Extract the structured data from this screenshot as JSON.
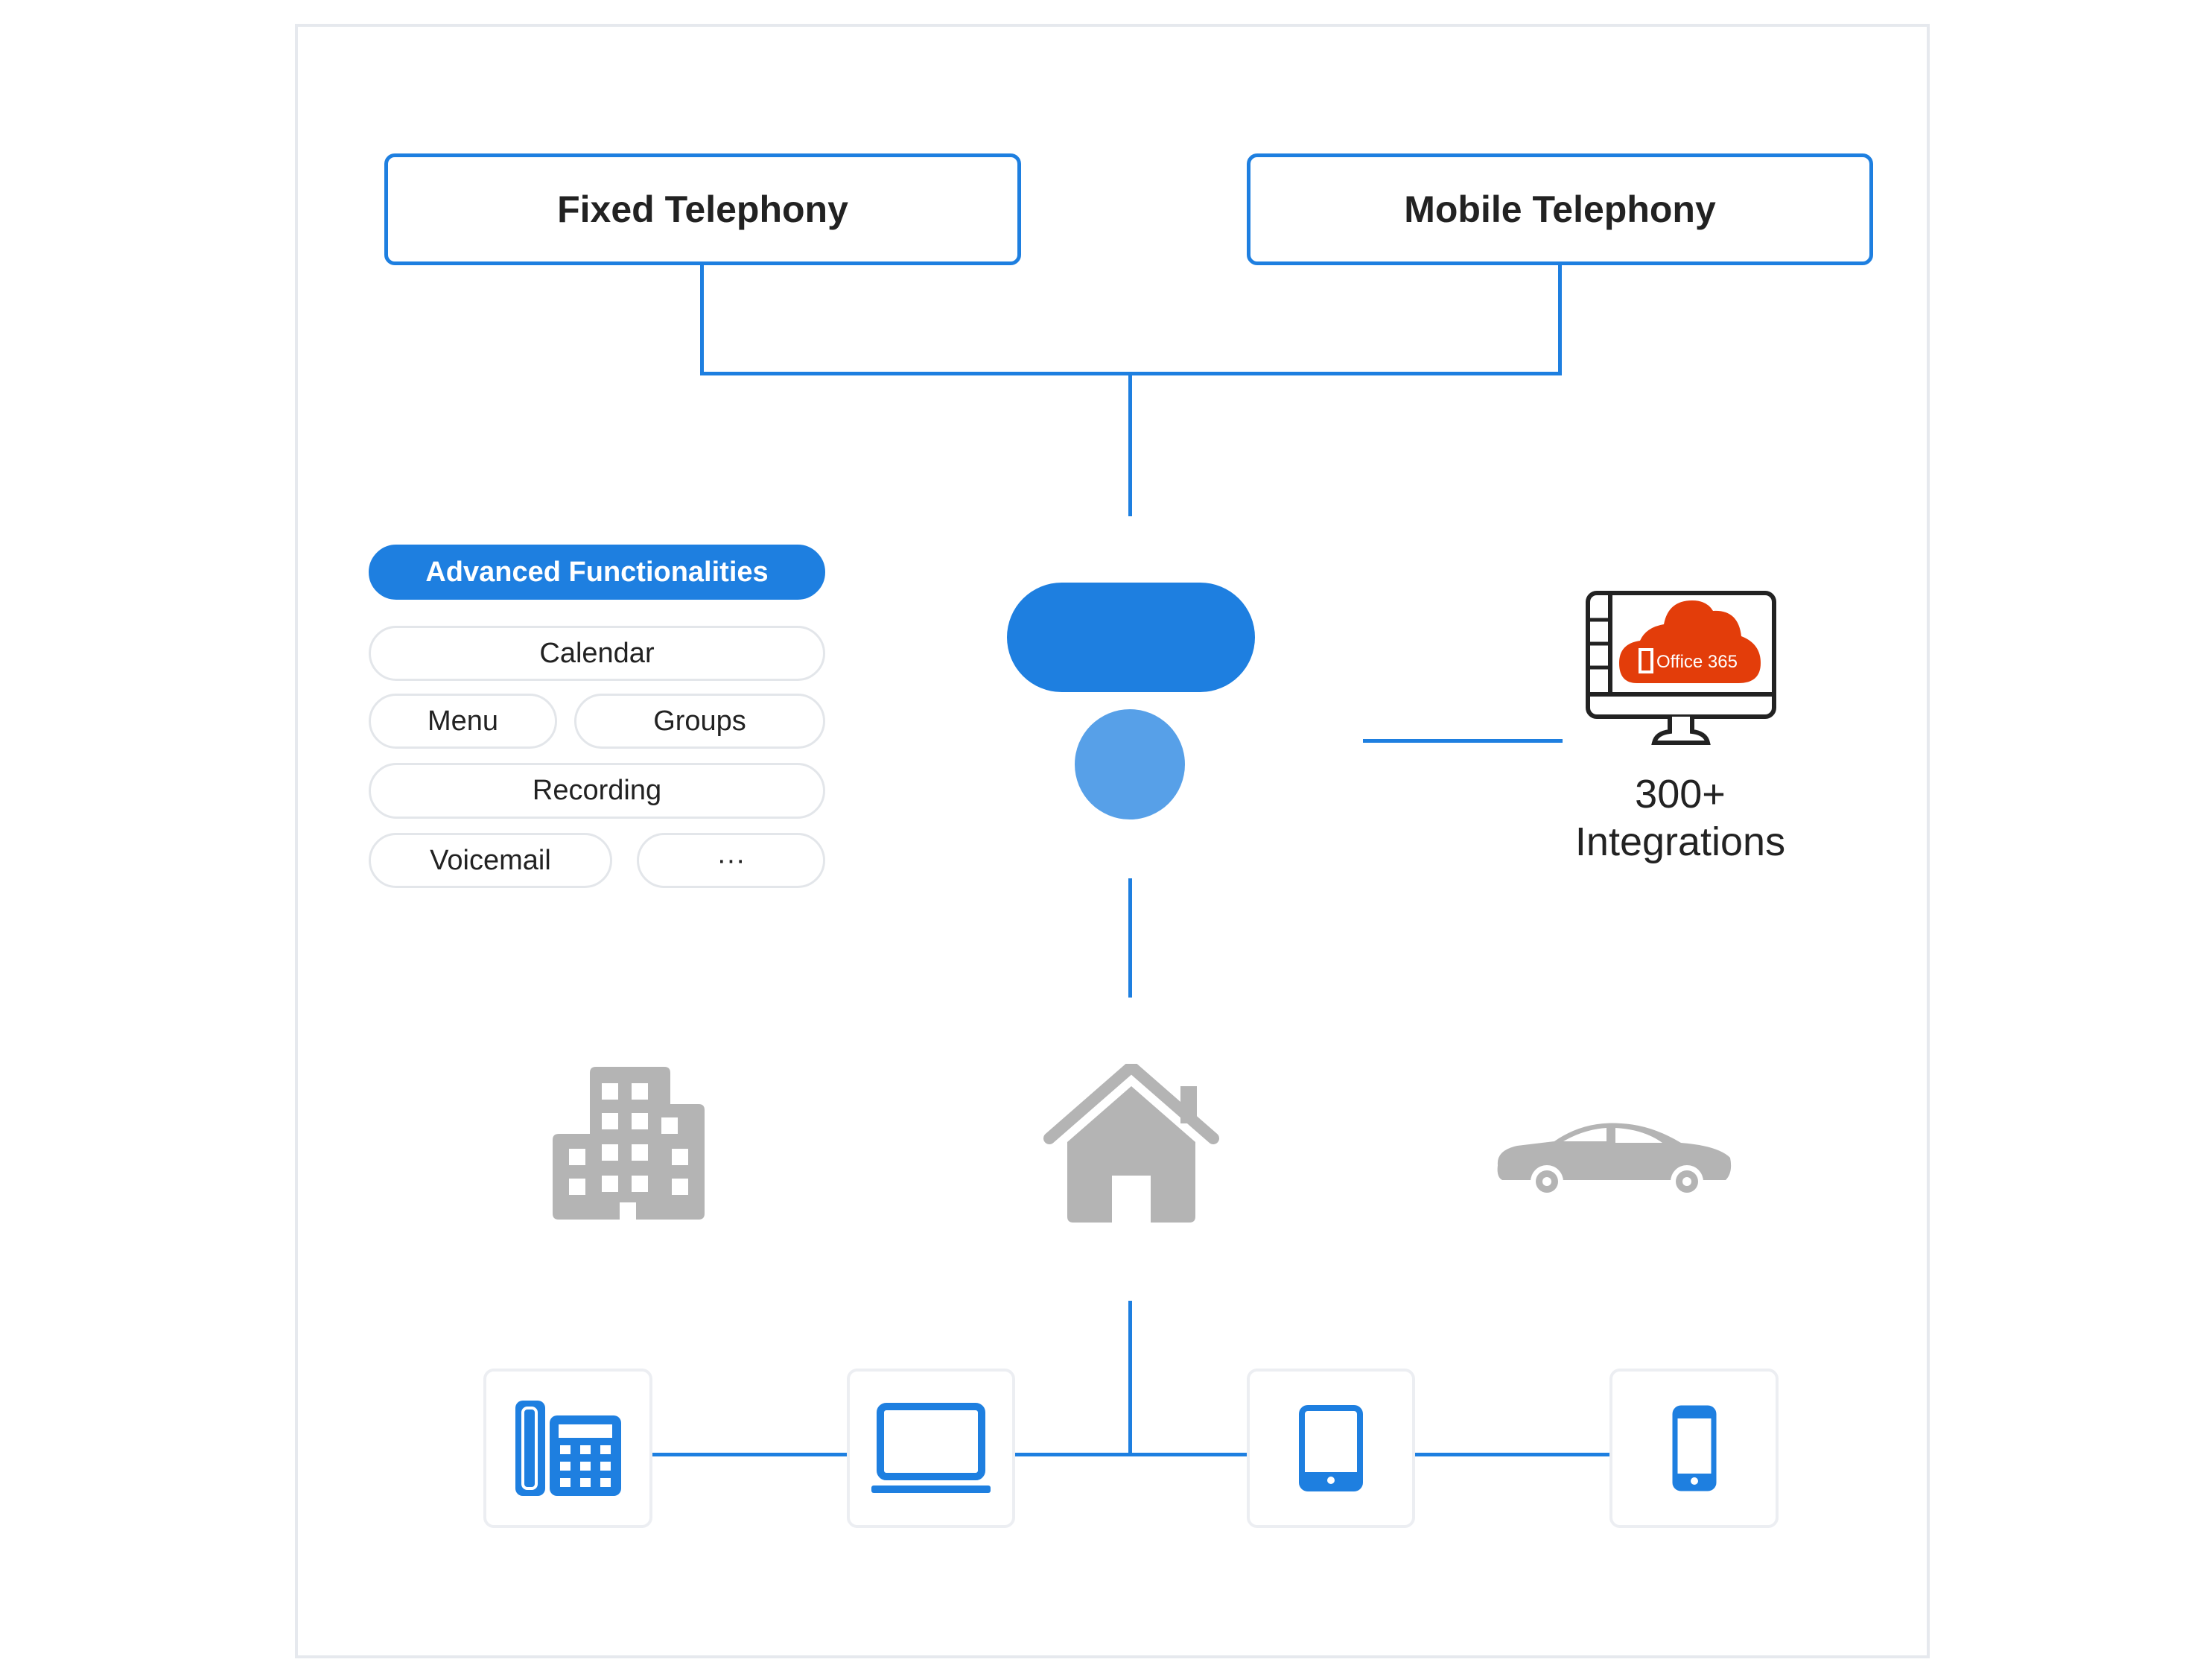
{
  "top_boxes": {
    "fixed": "Fixed Telephony",
    "mobile": "Mobile Telephony"
  },
  "features": {
    "title": "Advanced Functionalities",
    "items": [
      "Calendar",
      "Menu",
      "Groups",
      "Recording",
      "Voicemail",
      "···"
    ]
  },
  "integrations": {
    "count": "300+",
    "label": "Integrations",
    "logo_text": "Office 365"
  },
  "locations": [
    "office-building-icon",
    "home-icon",
    "car-icon"
  ],
  "devices": [
    "desk-phone-icon",
    "laptop-icon",
    "tablet-icon",
    "smartphone-icon"
  ],
  "colors": {
    "accent": "#1e7fe0",
    "accent_light": "#57a0e8",
    "office_orange": "#e33d0a",
    "icon_gray": "#b4b4b4"
  }
}
